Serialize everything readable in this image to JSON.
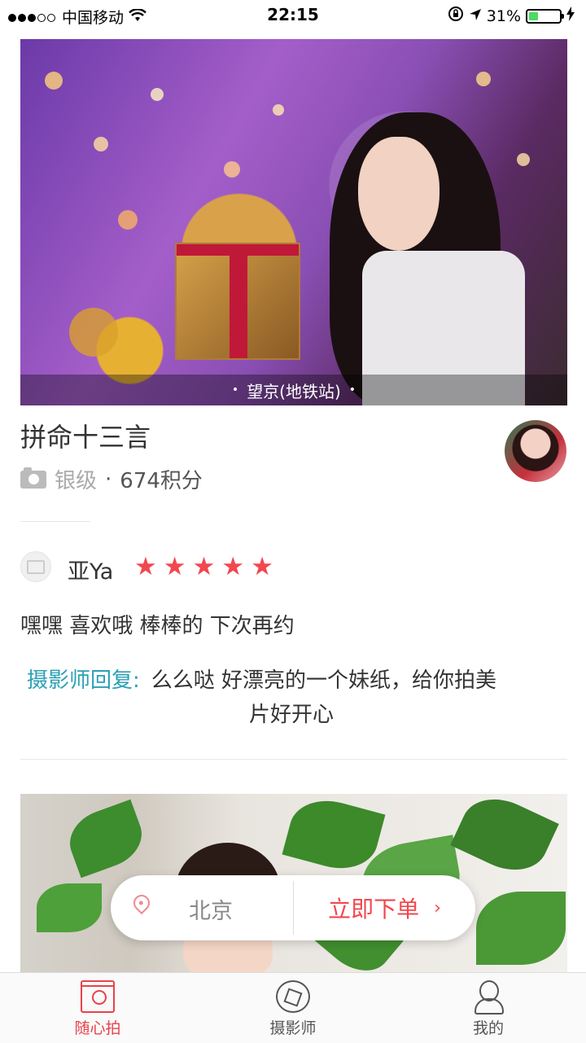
{
  "status_bar": {
    "carrier": "中国移动",
    "time": "22:15",
    "battery_percent": "31%",
    "icons": [
      "signal-dots-icon",
      "wifi-icon",
      "rotation-lock-icon",
      "location-arrow-icon",
      "battery-icon",
      "charging-bolt-icon"
    ]
  },
  "photo1": {
    "location_label": "望京(地铁站)"
  },
  "photographer": {
    "name": "拼命十三言",
    "level": "银级",
    "separator": "·",
    "points": "674积分"
  },
  "review": {
    "reviewer": "亚Ya",
    "rating": 5,
    "text": "嘿嘿 喜欢哦 棒棒的 下次再约",
    "reply_label": "摄影师回复:",
    "reply_line1": "么么哒 好漂亮的一个妹纸，给你拍美",
    "reply_line2": "片好开心"
  },
  "order_bar": {
    "city": "北京",
    "order_label": "立即下单",
    "chevron": "›"
  },
  "tabs": [
    {
      "label": "随心拍",
      "icon": "camera-icon",
      "active": true
    },
    {
      "label": "摄影师",
      "icon": "aperture-icon",
      "active": false
    },
    {
      "label": "我的",
      "icon": "user-icon",
      "active": false
    }
  ],
  "colors": {
    "accent": "#e8434a",
    "star": "#f2474e",
    "reply_label": "#2aa0b4"
  }
}
